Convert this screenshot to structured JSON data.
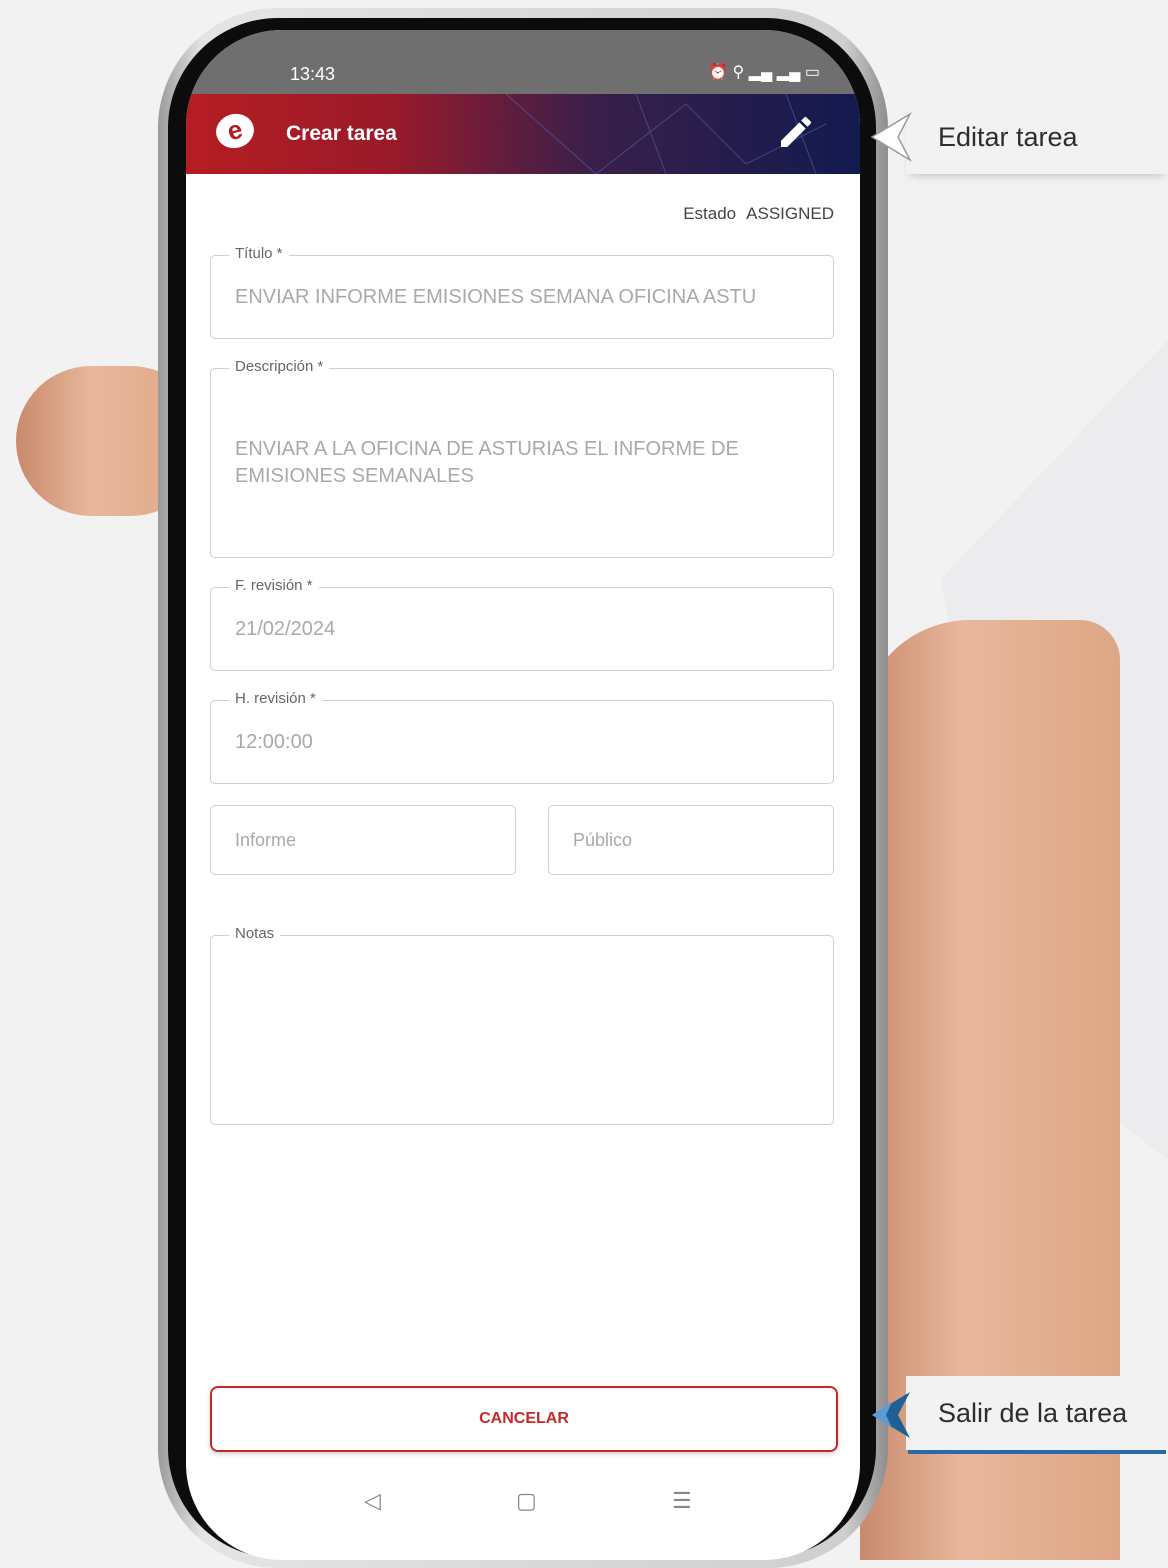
{
  "status_bar": {
    "time": "13:43",
    "icons": "⏰ ⚲ ▂▄ ▂▄ ▭"
  },
  "app_bar": {
    "title": "Crear tarea",
    "logo_letter": "e",
    "edit_icon": "pencil-icon"
  },
  "estado": {
    "label": "Estado",
    "value": "ASSIGNED"
  },
  "form": {
    "titulo": {
      "label": "Título *",
      "value": "ENVIAR INFORME EMISIONES SEMANA OFICINA ASTU"
    },
    "descripcion": {
      "label": "Descripción *",
      "value": "ENVIAR A LA OFICINA DE ASTURIAS EL INFORME DE EMISIONES SEMANALES"
    },
    "f_revision": {
      "label": "F. revisión *",
      "value": "21/02/2024"
    },
    "h_revision": {
      "label": "H. revisión *",
      "value": "12:00:00"
    },
    "informe": {
      "placeholder": "Informe"
    },
    "publico": {
      "placeholder": "Público"
    },
    "notas": {
      "label": "Notas",
      "value": ""
    }
  },
  "cancel_button": {
    "label": "CANCELAR"
  },
  "nav": {
    "back": "◁",
    "home": "▢",
    "menu": "☰"
  },
  "callouts": {
    "edit": {
      "text": "Editar tarea"
    },
    "exit": {
      "text": "Salir de la tarea"
    }
  },
  "colors": {
    "accent_red": "#c62828",
    "appbar_dark": "#121a4e",
    "callout_arrow_blue": "#1f5f96"
  }
}
